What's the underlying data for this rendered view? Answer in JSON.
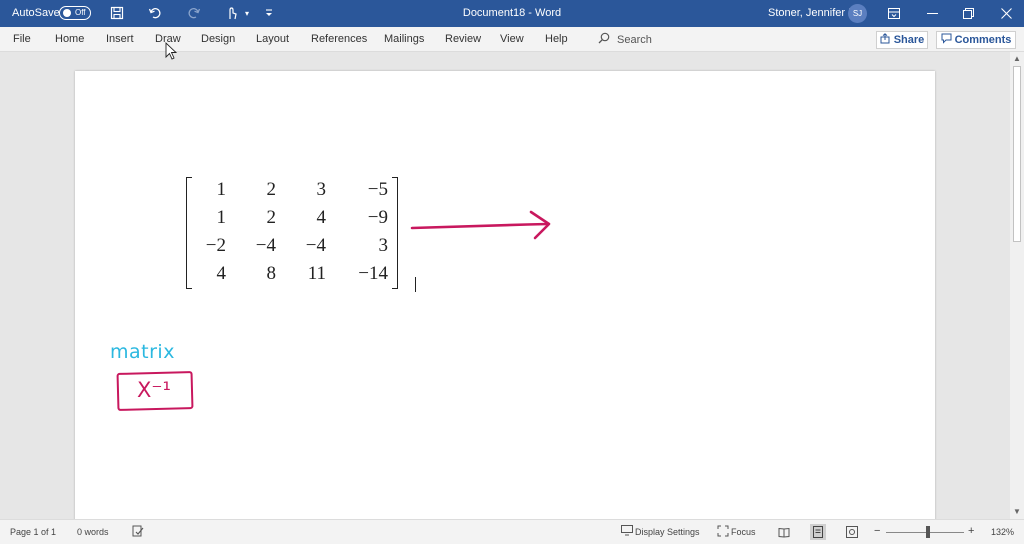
{
  "titlebar": {
    "autosave_label": "AutoSave",
    "autosave_state": "Off",
    "document_title": "Document18  -  Word",
    "user_name": "Stoner, Jennifer L",
    "user_initials": "SJ"
  },
  "ribbon": {
    "tabs": [
      "File",
      "Home",
      "Insert",
      "Draw",
      "Design",
      "Layout",
      "References",
      "Mailings",
      "Review",
      "View",
      "Help"
    ],
    "search_label": "Search",
    "share_label": "Share",
    "comments_label": "Comments"
  },
  "document": {
    "matrix": [
      [
        "1",
        "2",
        "3",
        "−5"
      ],
      [
        "1",
        "2",
        "4",
        "−9"
      ],
      [
        "−2",
        "−4",
        "−4",
        "3"
      ],
      [
        "4",
        "8",
        "11",
        "−14"
      ]
    ],
    "ink": {
      "matrix_label": "matrix",
      "inverse_label": "X⁻¹",
      "arrow_color": "#c8185e",
      "label_color": "#2bb8e0"
    }
  },
  "statusbar": {
    "page_info": "Page 1 of 1",
    "word_count": "0 words",
    "display_settings": "Display Settings",
    "focus": "Focus",
    "zoom_minus": "−",
    "zoom_plus": "+",
    "zoom_level": "132%"
  },
  "colors": {
    "titlebar": "#2b579a",
    "ink_pink": "#c8185e",
    "ink_blue": "#2bb8e0"
  }
}
